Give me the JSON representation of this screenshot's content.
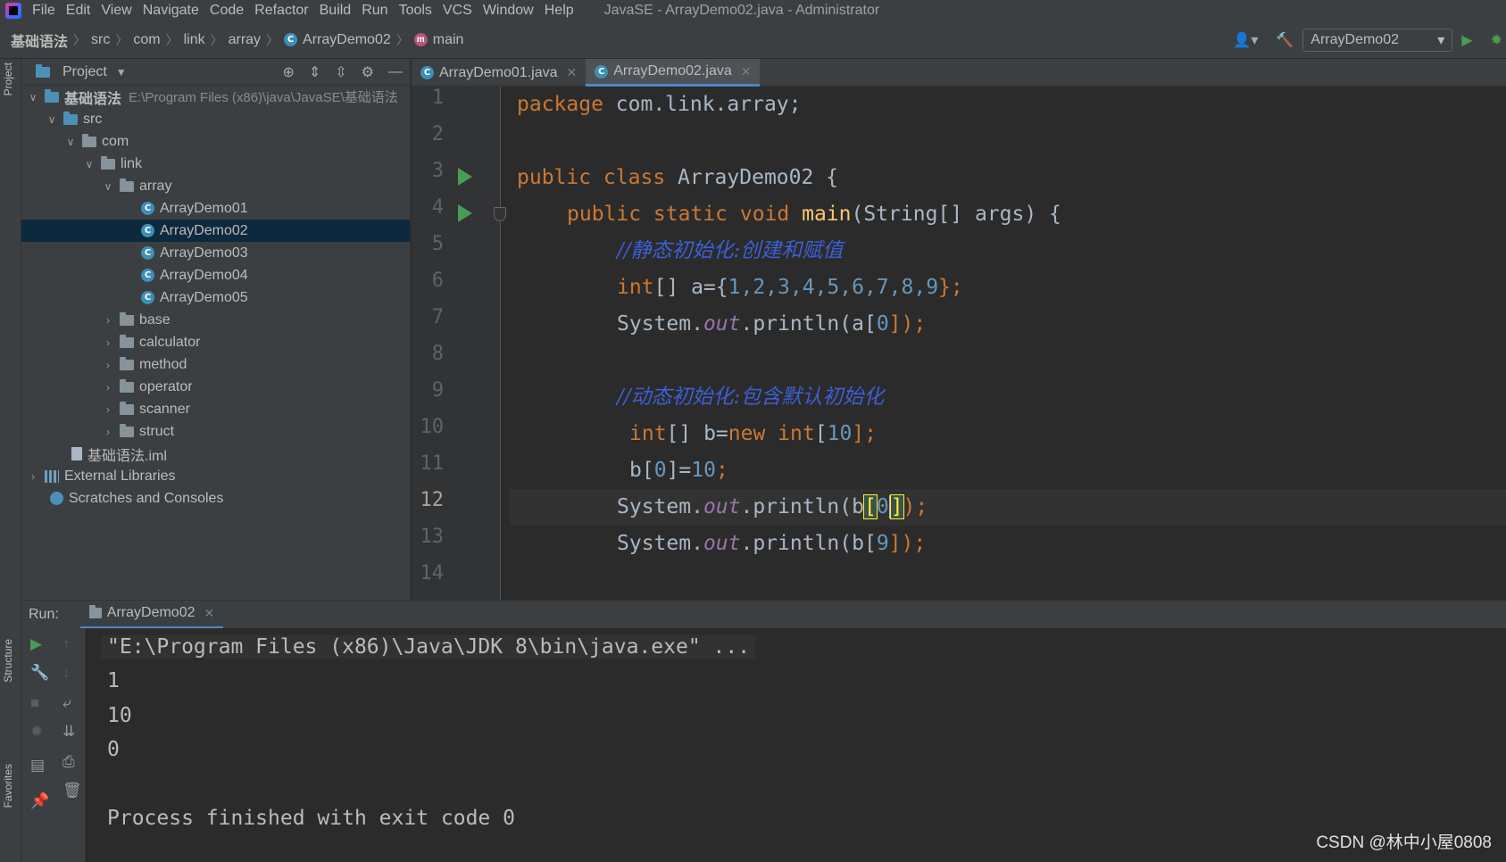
{
  "menu": {
    "items": [
      "File",
      "Edit",
      "View",
      "Navigate",
      "Code",
      "Refactor",
      "Build",
      "Run",
      "Tools",
      "VCS",
      "Window",
      "Help"
    ],
    "window_title": "JavaSE - ArrayDemo02.java - Administrator"
  },
  "breadcrumb": {
    "items": [
      "基础语法",
      "src",
      "com",
      "link",
      "array",
      "ArrayDemo02",
      "main"
    ]
  },
  "toolbar": {
    "run_config": "ArrayDemo02"
  },
  "side_tabs": {
    "project": "Project",
    "structure": "Structure",
    "favorites": "Favorites"
  },
  "project": {
    "title": "Project",
    "root_name": "基础语法",
    "root_path": "E:\\Program Files (x86)\\java\\JavaSE\\基础语法",
    "src": "src",
    "com": "com",
    "link": "link",
    "array": "array",
    "array_files": [
      "ArrayDemo01",
      "ArrayDemo02",
      "ArrayDemo03",
      "ArrayDemo04",
      "ArrayDemo05"
    ],
    "folders": [
      "base",
      "calculator",
      "method",
      "operator",
      "scanner",
      "struct"
    ],
    "iml": "基础语法.iml",
    "external_libraries": "External Libraries",
    "scratches": "Scratches and Consoles"
  },
  "tabs": [
    {
      "label": "ArrayDemo01.java",
      "active": false
    },
    {
      "label": "ArrayDemo02.java",
      "active": true
    }
  ],
  "editor": {
    "line_numbers": [
      "1",
      "2",
      "3",
      "4",
      "5",
      "6",
      "7",
      "8",
      "9",
      "10",
      "11",
      "12",
      "13",
      "14"
    ],
    "current_line": "12",
    "lines": {
      "l1_kw": "package",
      "l1_rest": " com.link.array;",
      "l3_kw": "public class",
      "l3_rest": " ArrayDemo02 {",
      "l4_kw": "public static void",
      "l4_fn": "main",
      "l4_rest": "(String[] args) {",
      "l5_comment": "//静态初始化:创建和赋值",
      "l6_kw": "int",
      "l6_mid": "[] a={",
      "l6_nums": "1,2,3,4,5,6,7,8,9",
      "l6_end": "};",
      "l7_sys": "System.",
      "l7_out": "out",
      "l7_call": ".println(a[",
      "l7_idx": "0",
      "l7_end": "]);",
      "l9_comment": "//动态初始化:包含默认初始化",
      "l10_kw": "int",
      "l10_mid": "[] b=",
      "l10_new": "new int",
      "l10_br": "[",
      "l10_num": "10",
      "l10_end": "];",
      "l11_pre": "b[",
      "l11_idx": "0",
      "l11_mid": "]=",
      "l11_num": "10",
      "l11_end": ";",
      "l12_sys": "System.",
      "l12_out": "out",
      "l12_call": ".println(b",
      "l12_open": "[",
      "l12_idx": "0",
      "l12_close": "]",
      "l12_end": ");",
      "l13_sys": "System.",
      "l13_out": "out",
      "l13_call": ".println(b[",
      "l13_idx": "9",
      "l13_end": "]);"
    }
  },
  "run": {
    "label": "Run:",
    "tab": "ArrayDemo02",
    "console": {
      "command": "\"E:\\Program Files (x86)\\Java\\JDK 8\\bin\\java.exe\" ...",
      "outputs": [
        "1",
        "10",
        "0"
      ],
      "finish": "Process finished with exit code 0"
    }
  },
  "watermark": "CSDN @林中小屋0808",
  "colors": {
    "keyword": "#cc7832",
    "number": "#6897bb",
    "comment": "#3c5fd6",
    "method": "#ffc66d",
    "static_field": "#9876aa",
    "selection": "#0d293e",
    "run_green": "#499c54"
  }
}
